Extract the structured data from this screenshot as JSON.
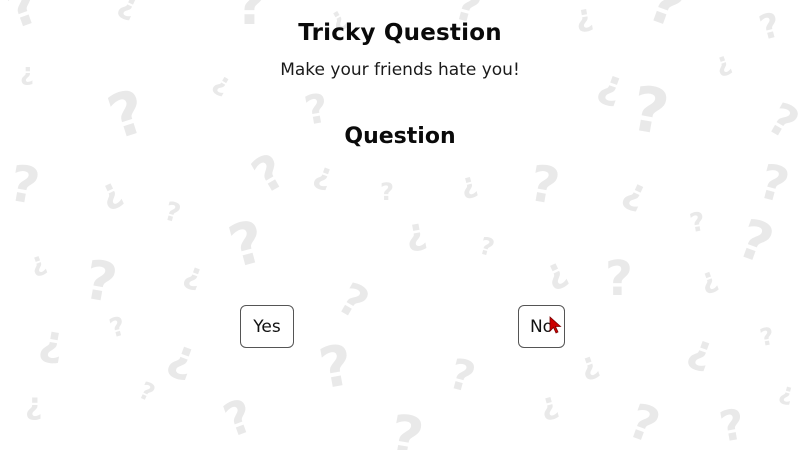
{
  "header": {
    "title": "Tricky Question",
    "subtitle": "Make your friends hate you!"
  },
  "main": {
    "question_heading": "Question",
    "question_text": ""
  },
  "buttons": {
    "yes_label": "Yes",
    "no_label": "No"
  },
  "background": {
    "pattern_glyphs": [
      "?",
      "¿"
    ],
    "pattern_color": "#e9e9e9"
  },
  "colors": {
    "background": "#ffffff",
    "text": "#0a0a0a",
    "button_border": "#555555",
    "cursor": "#cc0000"
  },
  "cursor": {
    "icon": "mouse-pointer-icon"
  }
}
